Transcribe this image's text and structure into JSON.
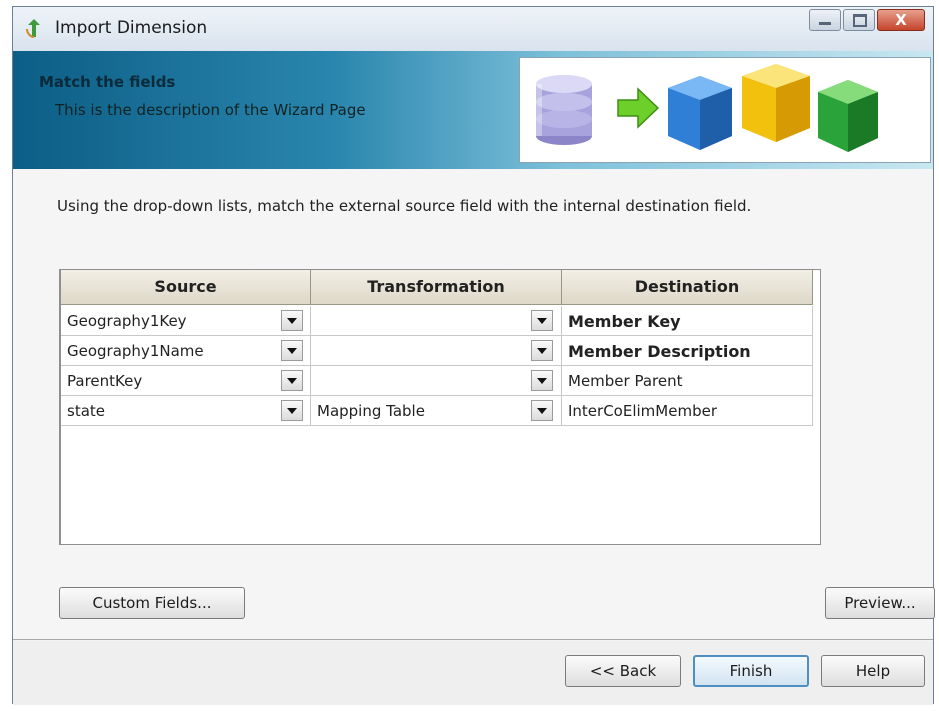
{
  "window": {
    "title": "Import Dimension",
    "close_glyph": "X"
  },
  "banner": {
    "title": "Match the fields",
    "description": "This is the description of the Wizard Page"
  },
  "instruction": "Using the drop-down lists, match the external source field with the internal destination field.",
  "grid": {
    "headers": [
      "Source",
      "Transformation",
      "Destination"
    ],
    "rows": [
      {
        "source": "Geography1Key",
        "transformation": "",
        "destination": "Member Key",
        "destination_bold": true
      },
      {
        "source": "Geography1Name",
        "transformation": "",
        "destination": "Member Description",
        "destination_bold": true
      },
      {
        "source": "ParentKey",
        "transformation": "",
        "destination": "Member Parent",
        "destination_bold": false
      },
      {
        "source": "state",
        "transformation": "Mapping Table",
        "destination": "InterCoElimMember",
        "destination_bold": false
      }
    ]
  },
  "buttons": {
    "custom_fields": "Custom Fields...",
    "preview": "Preview...",
    "back": "<< Back",
    "finish": "Finish",
    "help": "Help"
  },
  "colors": {
    "banner_dark": "#0c5e86",
    "banner_light": "#c8e7f1",
    "default_button_border": "#4c8fc0",
    "cube_blue": "#2f7fd6",
    "cube_yellow": "#f2c10e",
    "cube_green": "#2aa33a",
    "arrow_green": "#6dcf2a"
  },
  "icons": [
    "app-icon",
    "database-icon",
    "arrow-right-icon",
    "blue-cube-icon",
    "yellow-cube-icon",
    "green-cube-icon",
    "dropdown-arrow-icon"
  ]
}
